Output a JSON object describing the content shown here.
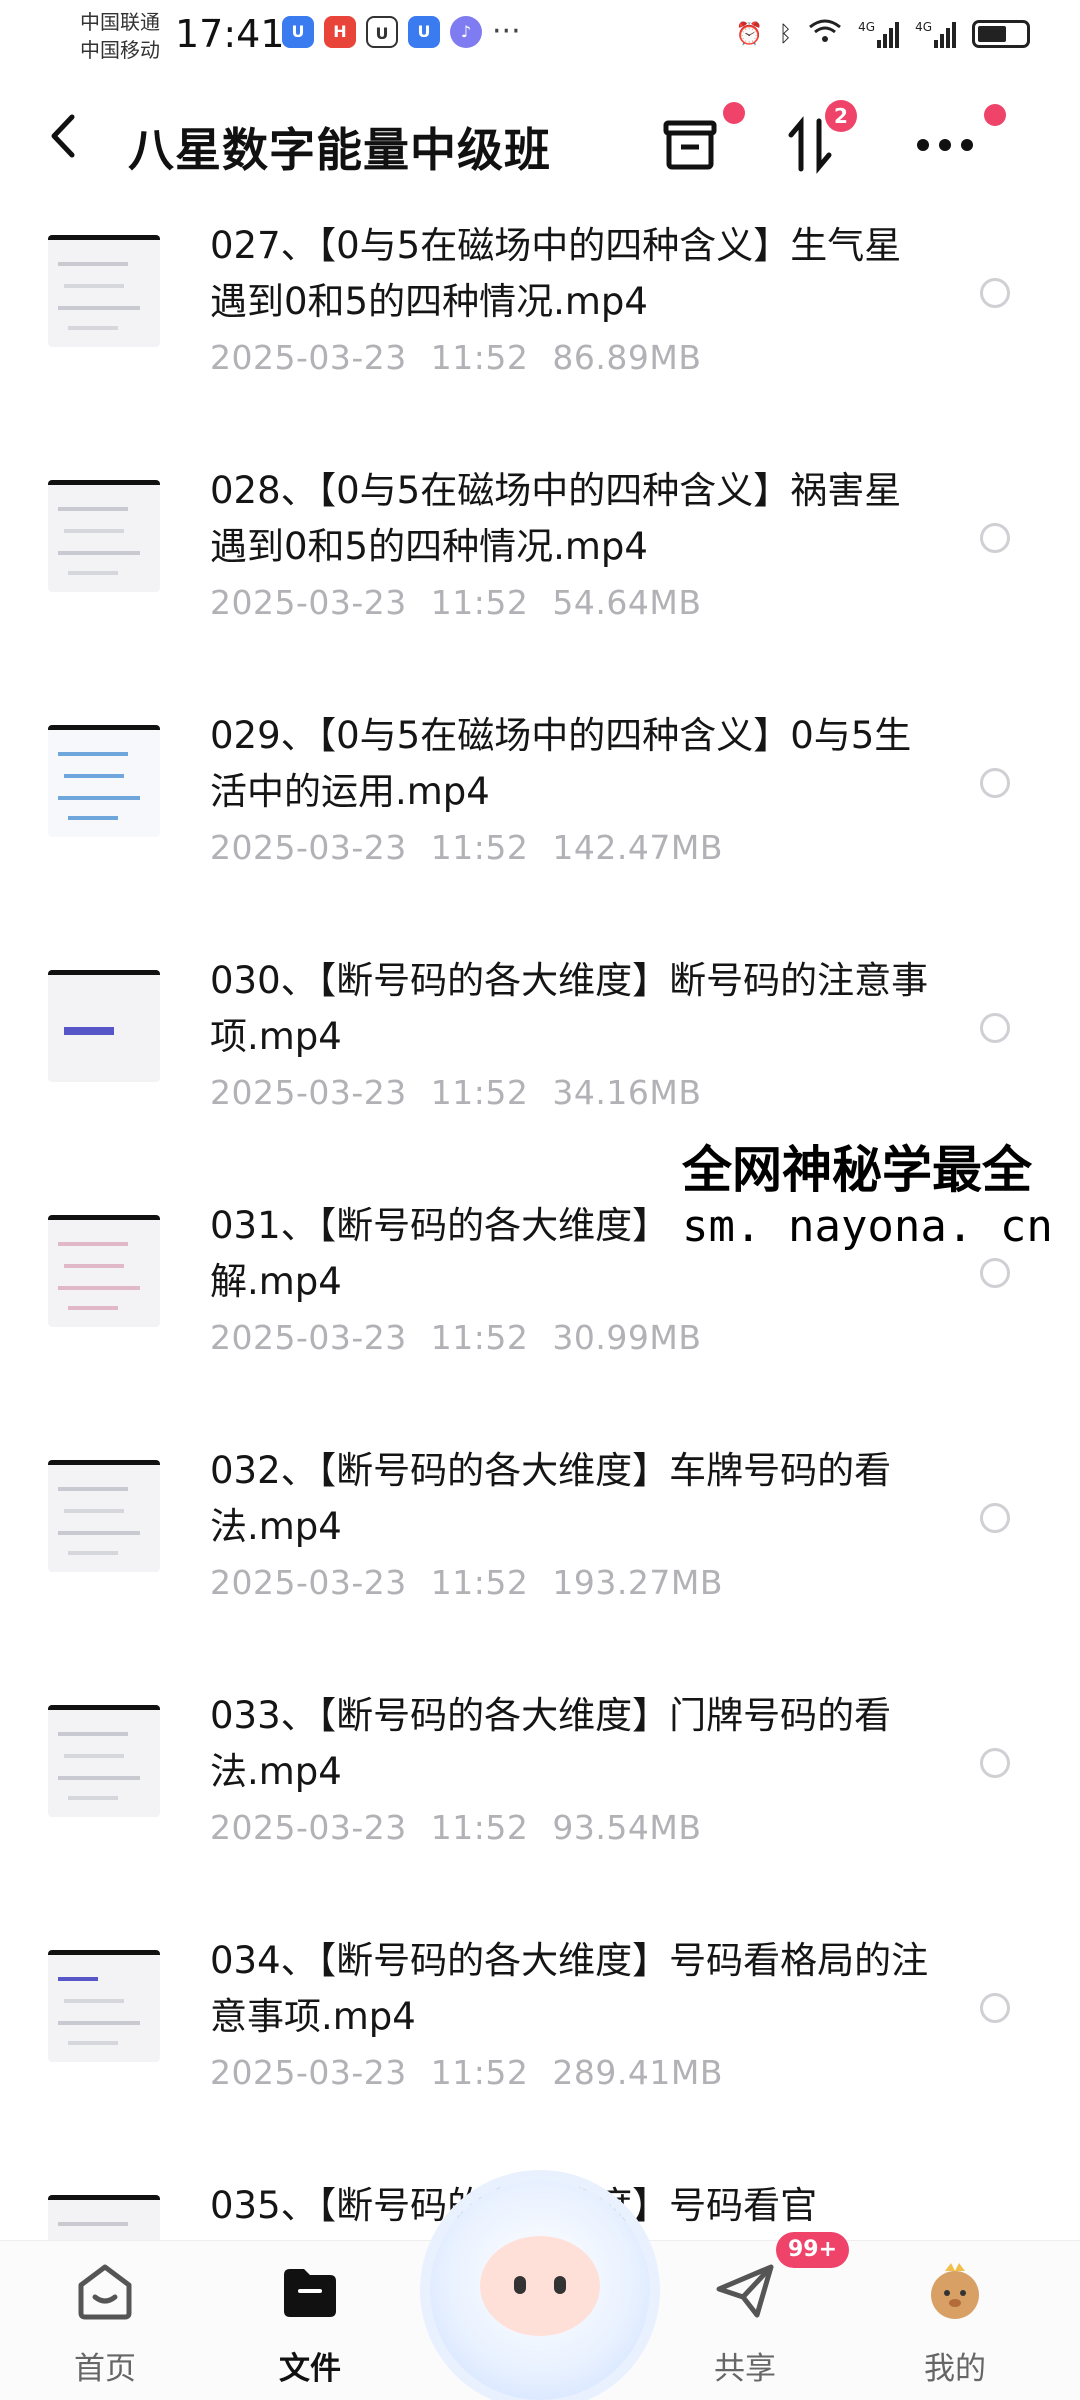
{
  "status_bar": {
    "carrier1": "中国联通",
    "carrier2": "中国移动",
    "time": "17:41",
    "more": "···",
    "net1": "4G",
    "net2": "4G"
  },
  "header": {
    "back_icon": "chevron-left-icon",
    "title": "八星数字能量中级班",
    "transfer_badge": "2"
  },
  "files": [
    {
      "name": "027、【0与5在磁场中的四种含义】生气星遇到0和5的四种情况.mp4",
      "date": "2025-03-23",
      "time": "11:52",
      "size": "86.89MB"
    },
    {
      "name": "028、【0与5在磁场中的四种含义】祸害星遇到0和5的四种情况.mp4",
      "date": "2025-03-23",
      "time": "11:52",
      "size": "54.64MB"
    },
    {
      "name": "029、【0与5在磁场中的四种含义】0与5生活中的运用.mp4",
      "date": "2025-03-23",
      "time": "11:52",
      "size": "142.47MB"
    },
    {
      "name": "030、【断号码的各大维度】断号码的注意事项.mp4",
      "date": "2025-03-23",
      "time": "11:52",
      "size": "34.16MB"
    },
    {
      "name": "031、【断号码的各大维度】",
      "name2": "解.mp4",
      "date": "2025-03-23",
      "time": "11:52",
      "size": "30.99MB"
    },
    {
      "name": "032、【断号码的各大维度】车牌号码的看法.mp4",
      "date": "2025-03-23",
      "time": "11:52",
      "size": "193.27MB"
    },
    {
      "name": "033、【断号码的各大维度】门牌号码的看法.mp4",
      "date": "2025-03-23",
      "time": "11:52",
      "size": "93.54MB"
    },
    {
      "name": "034、【断号码的各大维度】号码看格局的注意事项.mp4",
      "date": "2025-03-23",
      "time": "11:52",
      "size": "289.41MB"
    },
    {
      "name": "035、【断号码的各大维度】号码看官",
      "date": "",
      "time": "",
      "size": ""
    }
  ],
  "watermark": {
    "line1": "全网神秘学最全",
    "line2": "sm. nayona. cn"
  },
  "bottom_nav": {
    "home": "首页",
    "files": "文件",
    "share": "共享",
    "mine": "我的",
    "share_badge": "99+"
  },
  "colors": {
    "accent_red": "#f0436a",
    "meta_gray": "#b1b1b6"
  }
}
